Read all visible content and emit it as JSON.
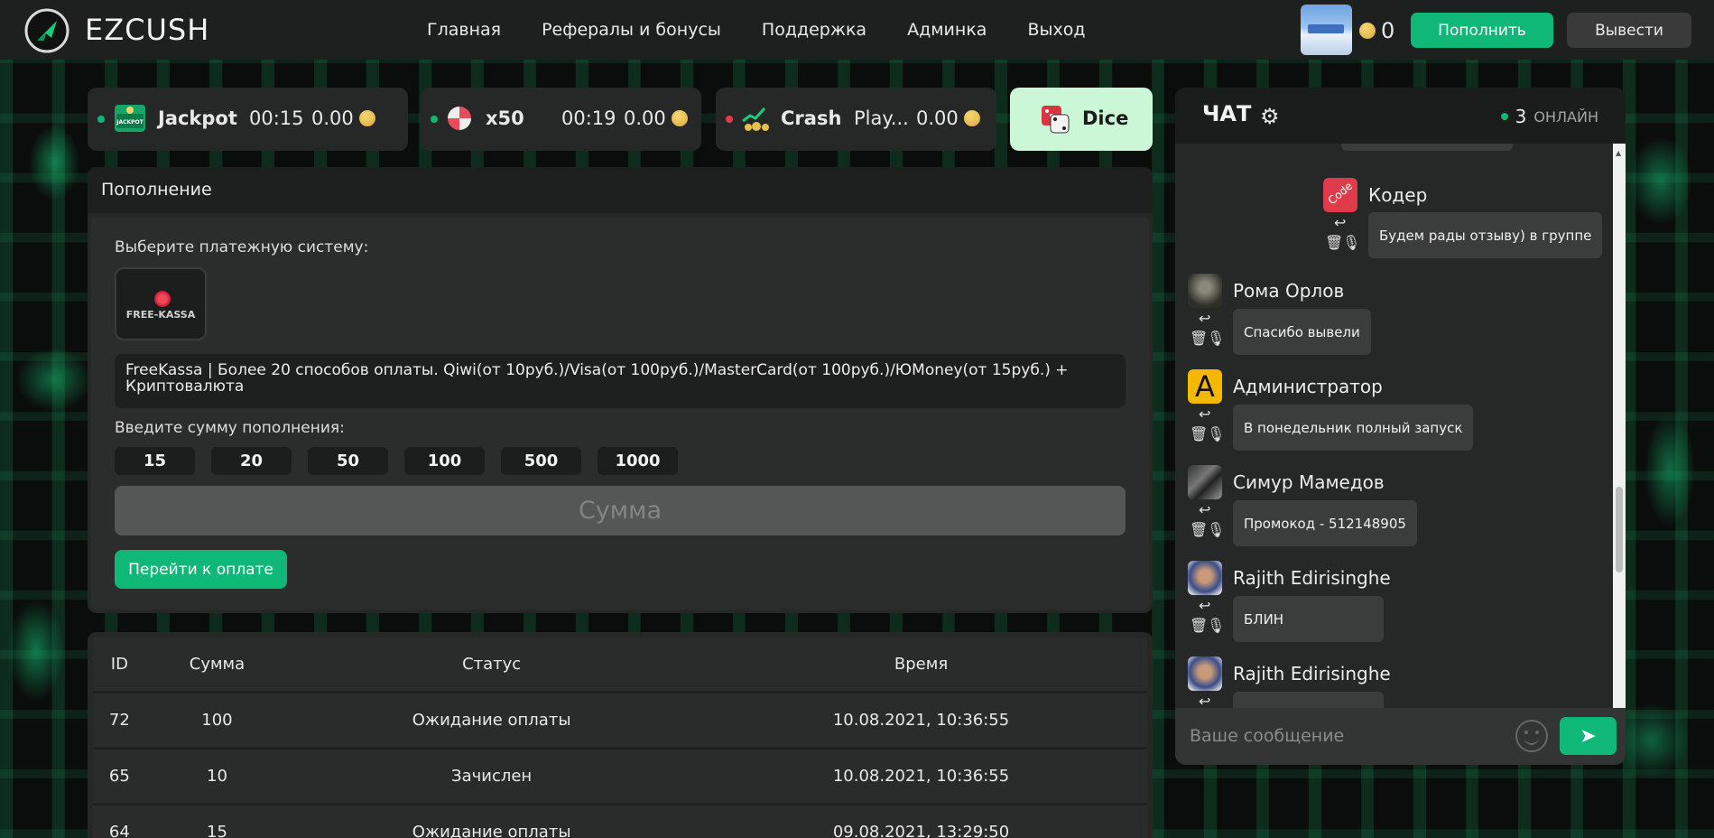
{
  "header": {
    "logo_text": "EZCUSH",
    "nav": [
      "Главная",
      "Рефералы и бонусы",
      "Поддержка",
      "Админка",
      "Выход"
    ],
    "balance": "0",
    "deposit_label": "Пополнить",
    "withdraw_label": "Вывести"
  },
  "games": {
    "jackpot": {
      "name": "Jackpot",
      "time": "00:15",
      "value": "0.00",
      "status_color": "#10b877"
    },
    "x50": {
      "name": "x50",
      "time": "00:19",
      "value": "0.00",
      "status_color": "#10b877"
    },
    "crash": {
      "name": "Crash",
      "time": "Play...",
      "value": "0.00",
      "status_color": "#e03b4a"
    },
    "dice": {
      "name": "Dice"
    }
  },
  "deposit": {
    "title": "Пополнение",
    "choose_label": "Выберите платежную систему:",
    "provider_logo_text": "FREE-KASSA",
    "provider_description": "FreeKassa | Более 20 способов оплаты. Qiwi(от 10руб.)/Visa(от 100руб.)/MasterCard(от 100руб.)/ЮMoney(от 15руб.) + Криптовалюта",
    "amount_label": "Введите сумму пополнения:",
    "amounts": [
      "15",
      "20",
      "50",
      "100",
      "500",
      "1000"
    ],
    "sum_placeholder": "Сумма",
    "pay_button": "Перейти к оплате"
  },
  "table": {
    "headers": [
      "ID",
      "Сумма",
      "Статус",
      "Время"
    ],
    "rows": [
      [
        "72",
        "100",
        "Ожидание оплаты",
        "10.08.2021, 10:36:55"
      ],
      [
        "65",
        "10",
        "Зачислен",
        "10.08.2021, 10:36:55"
      ],
      [
        "64",
        "15",
        "Ожидание оплаты",
        "09.08.2021, 13:29:50"
      ]
    ]
  },
  "chat": {
    "title": "ЧАТ",
    "online_count": "3",
    "online_label": "ОНЛАЙН",
    "input_placeholder": "Ваше сообщение",
    "messages": [
      {
        "name": "Кодер",
        "text": "Будем рады отзыву) в группе",
        "avatar_text": "Code"
      },
      {
        "name": "Рома Орлов",
        "text": "Спасибо вывели"
      },
      {
        "name": "Администратор",
        "text": "В понедельник полный запуск",
        "avatar_text": "A"
      },
      {
        "name": "Симур Мамедов",
        "text": "Промокод - 512148905"
      },
      {
        "name": "Rajith Edirisinghe",
        "text": "БЛИН"
      },
      {
        "name": "Rajith Edirisinghe",
        "text": ""
      }
    ]
  },
  "colors": {
    "accent": "#10b877",
    "background": "#1e1f1f",
    "panel": "#262727"
  }
}
